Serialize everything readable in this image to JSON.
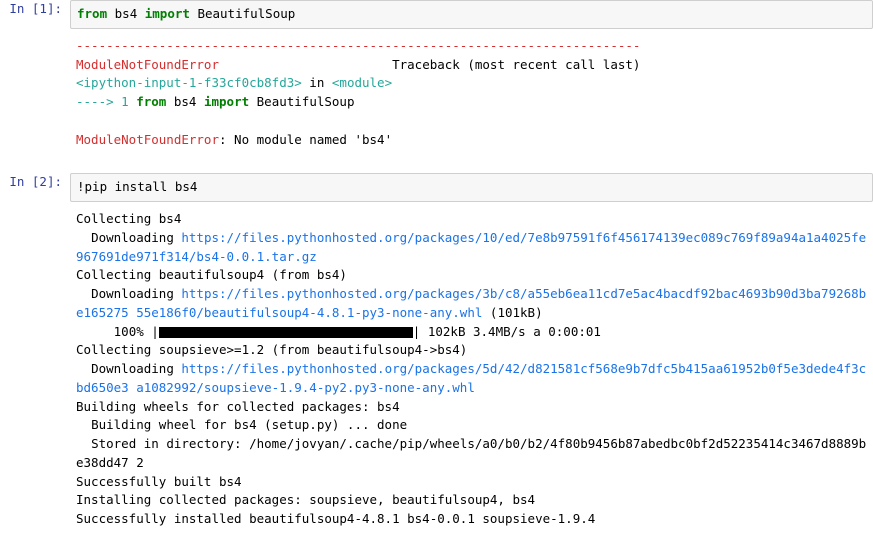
{
  "cell1": {
    "prompt": "In [1]:",
    "code": {
      "from": "from",
      "mod": "bs4",
      "import": "import",
      "name": "BeautifulSoup"
    },
    "err": {
      "dashes": "---------------------------------------------------------------------------",
      "err_name": "ModuleNotFoundError",
      "tb_label": "Traceback (most recent call last)",
      "frame": "<ipython-input-1-f33cf0cb8fd3>",
      "in_word": " in ",
      "module": "<module>",
      "arrow": "----> 1 ",
      "from2": "from",
      "mod2": " bs4 ",
      "import2": "import",
      "name2": " BeautifulSoup",
      "final_err": "ModuleNotFoundError",
      "final_msg": ": No module named 'bs4'"
    }
  },
  "cell2": {
    "prompt": "In [2]:",
    "code": "!pip install bs4",
    "out": {
      "l1": "Collecting bs4",
      "l2a": "  Downloading ",
      "l2b": "https://files.pythonhosted.org/packages/10/ed/7e8b97591f6f456174139ec089c769f89a94a1a4025fe967691de971f314/bs4-0.0.1.tar.gz",
      "l3": "Collecting beautifulsoup4 (from bs4)",
      "l4a": "  Downloading ",
      "l4b": "https://files.pythonhosted.org/packages/3b/c8/a55eb6ea11cd7e5ac4bacdf92bac4693b90d3ba79268be165275 55e186f0/beautifulsoup4-4.8.1-py3-none-any.whl",
      "l4c": " (101kB)",
      "prog_pre": "     100% |",
      "prog_post": "| 102kB 3.4MB/s a 0:00:01",
      "l5": "Collecting soupsieve>=1.2 (from beautifulsoup4->bs4)",
      "l6a": "  Downloading ",
      "l6b": "https://files.pythonhosted.org/packages/5d/42/d821581cf568e9b7dfc5b415aa61952b0f5e3dede4f3cbd650e3 a1082992/soupsieve-1.9.4-py2.py3-none-any.whl",
      "l7": "Building wheels for collected packages: bs4",
      "l8": "  Building wheel for bs4 (setup.py) ... done",
      "l9": "  Stored in directory: /home/jovyan/.cache/pip/wheels/a0/b0/b2/4f80b9456b87abedbc0bf2d52235414c3467d8889be38dd47 2",
      "l10": "Successfully built bs4",
      "l11": "Installing collected packages: soupsieve, beautifulsoup4, bs4",
      "l12": "Successfully installed beautifulsoup4-4.8.1 bs4-0.0.1 soupsieve-1.9.4"
    }
  }
}
